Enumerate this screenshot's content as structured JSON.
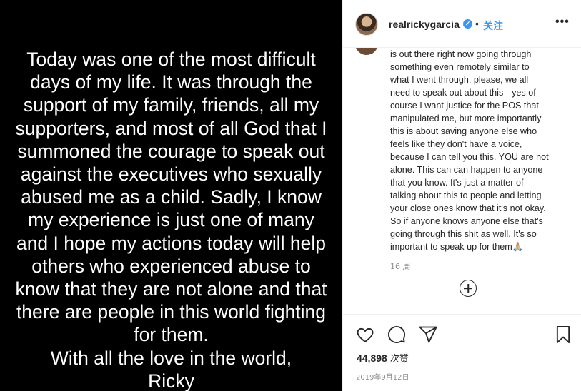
{
  "post_image": {
    "lines": [
      "Today was one of the most difficult",
      "days of my life. It was through the",
      "support of my family, friends, all my",
      "supporters, and most of all God that I",
      "summoned the courage to speak out",
      "against the executives who sexually",
      "abused me as a child. Sadly, I know",
      "my experience is just one of many",
      "and I hope my actions today will help",
      "others who experienced abuse to",
      "know that they are not alone and that",
      "there are people in this world fighting",
      "for them.",
      "With all the love in the world,",
      "Ricky"
    ]
  },
  "header": {
    "username": "realrickygarcia",
    "verified_glyph": "✓",
    "separator": "•",
    "follow_label": "关注",
    "more_glyph": "•••"
  },
  "caption": {
    "lines": [
      "is out there right now going through",
      "something even remotely similar to",
      "what I went through, please, we all",
      "need to speak out about this-- yes of",
      "course I want justice for the POS that",
      "manipulated me, but more importantly",
      "this is about saving anyone else who",
      "feels like they don't have a voice,",
      "because I can tell you this. YOU are not",
      "alone. This can can happen to anyone",
      "that you know. It's just a matter of",
      "talking about this to people and letting",
      "your close ones know that it's not okay.",
      "So if anyone knows anyone else that's",
      "going through this shit as well. It's so",
      "important to speak up for them🙏🏼"
    ],
    "time_ago": "16 周"
  },
  "actions": {
    "icons": [
      "heart-icon",
      "comment-icon",
      "share-icon",
      "bookmark-icon"
    ],
    "likes_count": "44,898",
    "likes_unit": "次赞",
    "date": "2019年9月12日"
  }
}
